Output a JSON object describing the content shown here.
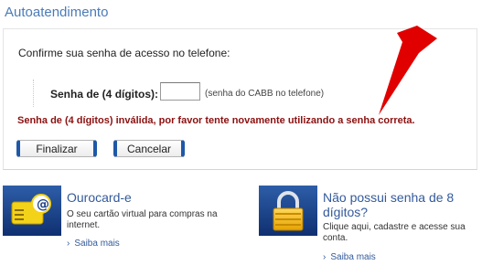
{
  "page": {
    "title": "Autoatendimento"
  },
  "form": {
    "prompt": "Confirme sua senha de acesso no telefone:",
    "password_label": "Senha de (4 dígitos):",
    "password_value": "",
    "password_hint": "(senha do CABB no telefone)",
    "error_message": "Senha de (4 dígitos) inválida, por favor tente novamente utilizando a senha correta.",
    "finalize_label": "Finalizar",
    "cancel_label": "Cancelar"
  },
  "promos": [
    {
      "icon": "ourocard-email-icon",
      "title": "Ourocard-e",
      "description": "O seu cartão virtual para compras na internet.",
      "link": "Saiba mais"
    },
    {
      "icon": "padlock-icon",
      "title": "Não possui senha de 8 dígitos?",
      "description": "Clique aqui, cadastre e acesse sua conta.",
      "link": "Saiba mais"
    }
  ],
  "colors": {
    "accent": "#1f58a8",
    "title": "#4a7bb7",
    "error": "#8b1010",
    "annotation_arrow": "#e10000"
  }
}
